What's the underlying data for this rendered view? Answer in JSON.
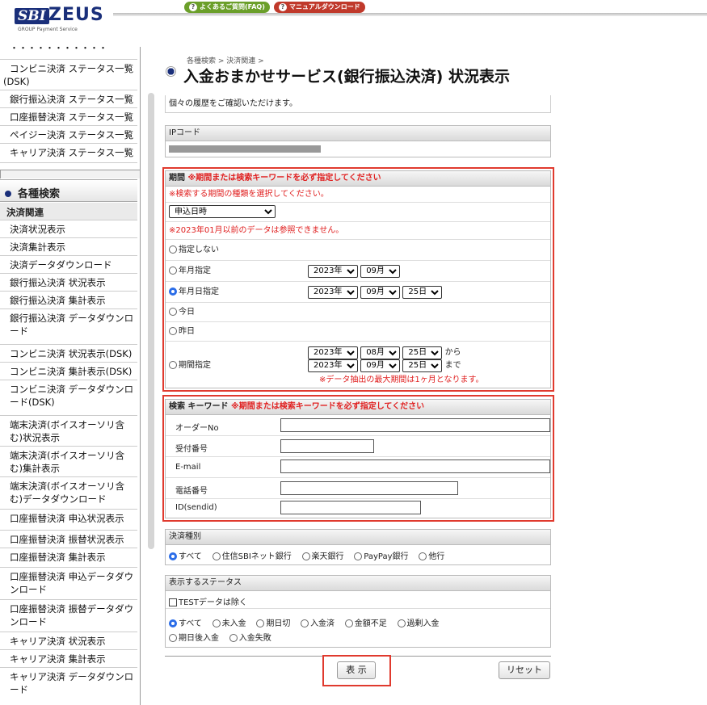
{
  "header": {
    "logo_sbi": "SBI",
    "logo_zeus": "ZEUS",
    "logo_sub": "GROUP  Payment Service",
    "faq_label": "よくあるご質問(FAQ)",
    "manual_label": "マニュアルダウンロード"
  },
  "sidebar": {
    "top_items": [
      "コンビニ決済 ステータス一覧(DSK)",
      "銀行振込決済 ステータス一覧",
      "口座振替決済 ステータス一覧",
      "ペイジー決済 ステータス一覧",
      "キャリア決済 ステータス一覧"
    ],
    "section_title": "各種検索",
    "subsection": "決済関連",
    "items": [
      "決済状況表示",
      "決済集計表示",
      "決済データダウンロード",
      "銀行振込決済 状況表示",
      "銀行振込決済 集計表示",
      "銀行振込決済 データダウンロード",
      "コンビニ決済 状況表示(DSK)",
      "コンビニ決済 集計表示(DSK)",
      "コンビニ決済 データダウンロード(DSK)",
      "端末決済(ボイスオーソリ含む)状況表示",
      "端末決済(ボイスオーソリ含む)集計表示",
      "端末決済(ボイスオーソリ含む)データダウンロード",
      "口座振替決済 申込状況表示",
      "口座振替決済 振替状況表示",
      "口座振替決済 集計表示",
      "口座振替決済 申込データダウンロード",
      "口座振替決済 振替データダウンロード",
      "キャリア決済 状況表示",
      "キャリア決済 集計表示",
      "キャリア決済 データダウンロード"
    ]
  },
  "page": {
    "breadcrumb": "各種検索 > 決済関連 >",
    "title": "入金おまかせサービス(銀行振込決済) 状況表示",
    "note": "個々の履歴をご確認いただけます。"
  },
  "ip": {
    "label": "IPコード"
  },
  "period": {
    "head": "期間",
    "head_note": "※期間または検索キーワードを必ず指定してください",
    "type_note": "※検索する期間の種類を選択してください。",
    "type_value": "申込日時",
    "limit_note": "※2023年01月以前のデータは参照できません。",
    "opt_none": "指定しない",
    "opt_month": "年月指定",
    "opt_date": "年月日指定",
    "opt_today": "今日",
    "opt_yesterday": "昨日",
    "opt_range": "期間指定",
    "month_year": "2023年",
    "month_month": "09月",
    "date_year": "2023年",
    "date_month": "09月",
    "date_day": "25日",
    "range_from_year": "2023年",
    "range_from_month": "08月",
    "range_from_day": "25日",
    "from_label": "から",
    "range_to_year": "2023年",
    "range_to_month": "09月",
    "range_to_day": "25日",
    "to_label": "まで",
    "range_note": "※データ抽出の最大期間は1ヶ月となります。"
  },
  "keyword": {
    "head": "検索 キーワード",
    "head_note": "※期間または検索キーワードを必ず指定してください",
    "order_no": "オーダーNo",
    "receipt_no": "受付番号",
    "email": "E-mail",
    "phone": "電話番号",
    "sendid": "ID(sendid)"
  },
  "payment_type": {
    "head": "決済種別",
    "options": [
      "すべて",
      "住信SBIネット銀行",
      "楽天銀行",
      "PayPay銀行",
      "他行"
    ]
  },
  "status": {
    "head": "表示するステータス",
    "exclude_test": "TESTデータは除く",
    "options": [
      "すべて",
      "未入金",
      "期日切",
      "入金済",
      "金額不足",
      "過剰入金",
      "期日後入金",
      "入金失敗"
    ]
  },
  "buttons": {
    "show": "表 示",
    "reset": "リセット"
  },
  "colors": {
    "brand": "#1a2f7a",
    "alert_red": "#e02020",
    "frame_red": "#e03a2e",
    "radio_blue": "#2b6de8"
  }
}
